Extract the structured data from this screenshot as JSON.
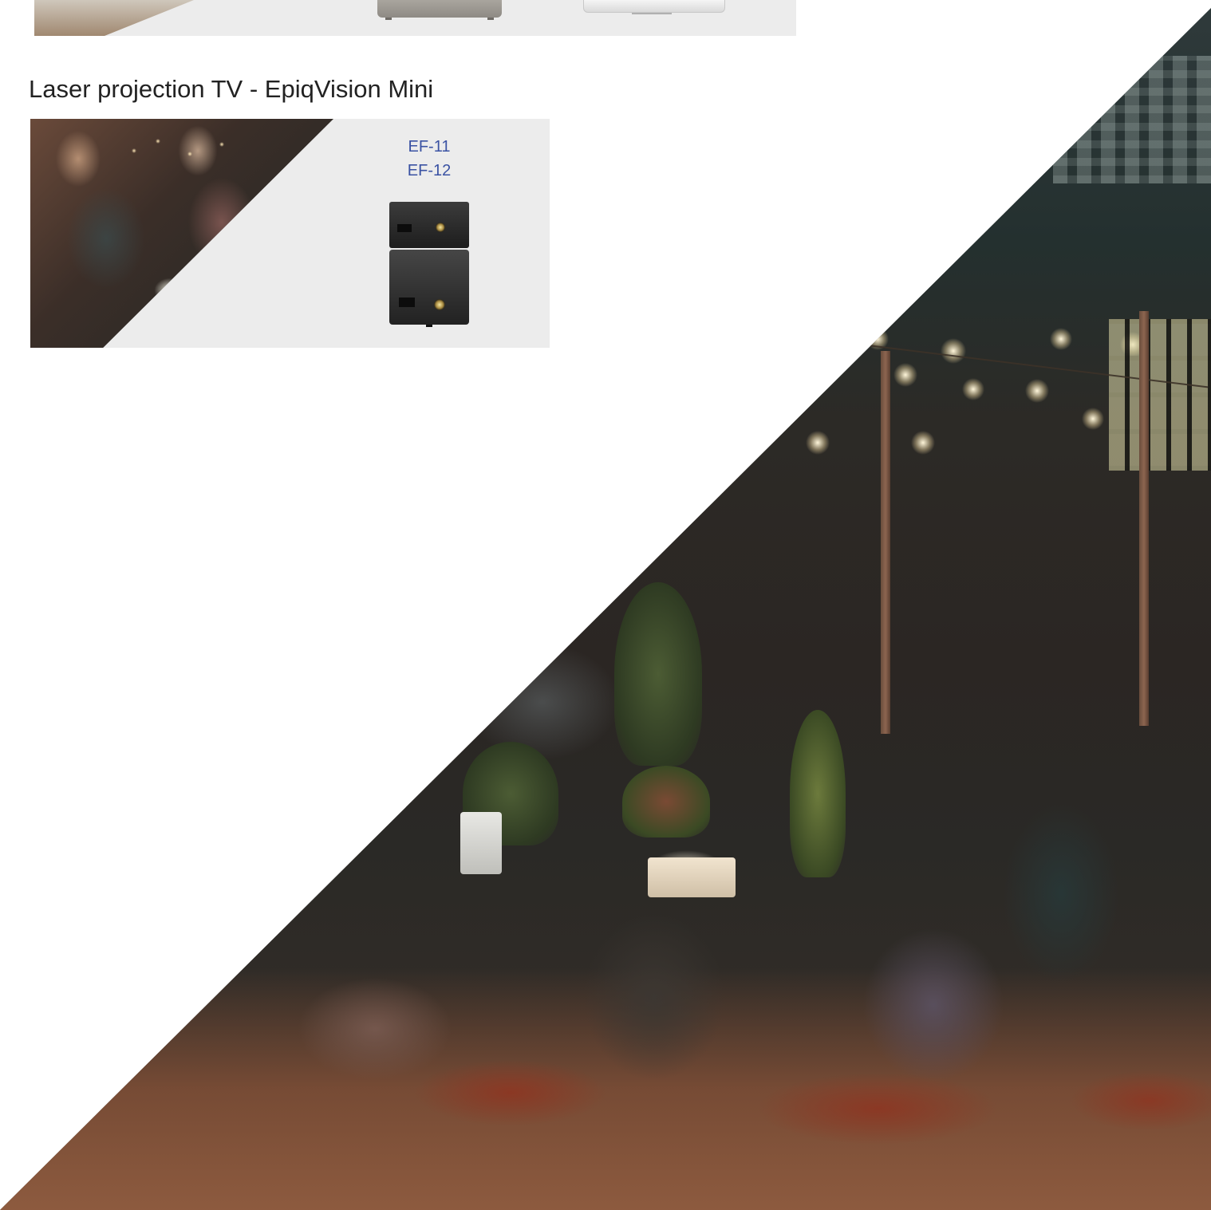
{
  "previous_card": {
    "photo_alt": "Lifestyle photo (cropped)",
    "product_images": [
      "grey-projector-icon",
      "white-projector-icon"
    ]
  },
  "section": {
    "title": "Laser projection TV - EpiqVision Mini"
  },
  "card": {
    "models": [
      {
        "label": "EF-11"
      },
      {
        "label": "EF-12"
      }
    ],
    "product_images": [
      "black-projector-small-icon",
      "black-projector-cube-icon"
    ]
  },
  "colors": {
    "link": "#3a52a3",
    "card_background": "#ececec",
    "title_text": "#222222"
  }
}
